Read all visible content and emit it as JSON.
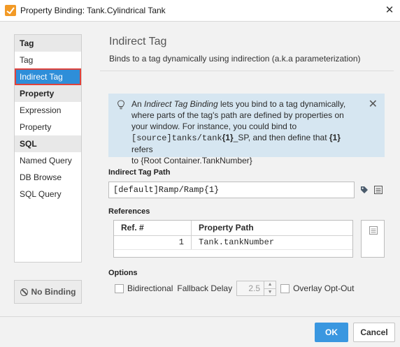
{
  "window": {
    "title": "Property Binding: Tank.Cylindrical Tank",
    "close_glyph": "✕"
  },
  "sidebar": {
    "groups": [
      {
        "header": "Tag",
        "items": [
          "Tag",
          "Indirect Tag"
        ]
      },
      {
        "header": "Property",
        "items": [
          "Expression",
          "Property"
        ]
      },
      {
        "header": "SQL",
        "items": [
          "Named Query",
          "DB Browse",
          "SQL Query"
        ]
      }
    ],
    "selected": "Indirect Tag",
    "no_binding_label": "No Binding"
  },
  "content": {
    "title": "Indirect Tag",
    "subtitle": "Binds to a tag dynamically using indirection (a.k.a parameterization)",
    "info": {
      "line1_a": "An ",
      "line1_em": "Indirect Tag Binding",
      "line1_b": " lets you bind to a tag dynamically,",
      "line2": "where parts of the tag's path are defined by properties on",
      "line3": "your window. For instance, you could bind to",
      "line4_code": "[source]tanks/tank",
      "line4_bold": "{1}",
      "line4_tail": "_SP, and then define that ",
      "line4_bold2": "{1}",
      "line4_end": " refers",
      "line5": "to {Root Container.TankNumber}"
    },
    "path_label": "Indirect Tag Path",
    "path_value": "[default]Ramp/Ramp{1}",
    "references_label": "References",
    "ref_columns": [
      "Ref. #",
      "Property Path"
    ],
    "ref_rows": [
      {
        "ref": "1",
        "path": "Tank.tankNumber"
      }
    ],
    "options_label": "Options",
    "bidirectional_label": "Bidirectional",
    "fallback_label": "Fallback Delay",
    "fallback_value": "2.5",
    "overlay_label": "Overlay Opt-Out"
  },
  "footer": {
    "ok": "OK",
    "cancel": "Cancel"
  },
  "colors": {
    "accent": "#2e8ed9",
    "highlight": "#e0413a",
    "info_bg": "#d6e6f1"
  },
  "icons": [
    "app-icon",
    "close-icon",
    "bulb-icon",
    "tag-icon",
    "list-icon",
    "no-binding-icon"
  ]
}
